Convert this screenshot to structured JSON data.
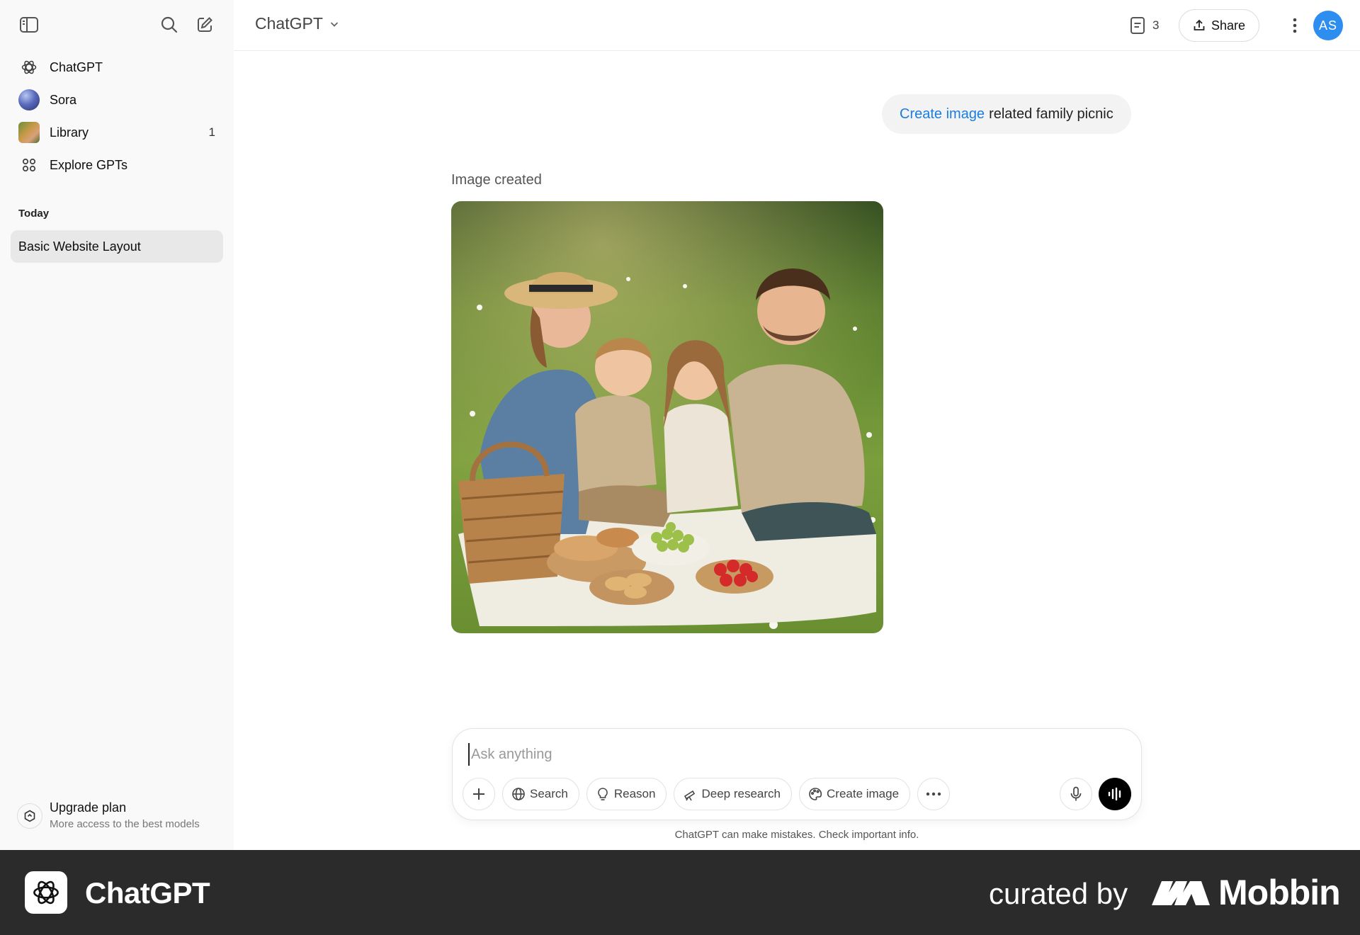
{
  "sidebar": {
    "nav": [
      {
        "label": "ChatGPT",
        "icon": "chatgpt-logo-icon"
      },
      {
        "label": "Sora",
        "icon": "sora-icon"
      },
      {
        "label": "Library",
        "icon": "library-thumbnail",
        "count": "1"
      },
      {
        "label": "Explore GPTs",
        "icon": "grid-icon"
      }
    ],
    "section_title": "Today",
    "chats": [
      {
        "label": "Basic Website Layout",
        "active": true
      }
    ],
    "upgrade": {
      "title": "Upgrade plan",
      "subtitle": "More access to the best models"
    }
  },
  "header": {
    "model": "ChatGPT",
    "doc_count": "3",
    "share_label": "Share",
    "avatar_initials": "AS"
  },
  "conversation": {
    "user_message": {
      "link_text": "Create image",
      "text": "related family picnic"
    },
    "image_caption": "Image created"
  },
  "composer": {
    "placeholder": "Ask anything",
    "tools": [
      "Search",
      "Reason",
      "Deep research",
      "Create image"
    ]
  },
  "disclaimer": "ChatGPT can make mistakes. Check important info.",
  "footer": {
    "app_name": "ChatGPT",
    "curated": "curated by",
    "brand": "Mobbin"
  },
  "colors": {
    "accent": "#1a7de3",
    "avatar": "#2e8ef0",
    "sidebar_bg": "#f9f9f9",
    "footer_bg": "#2b2b2b"
  }
}
